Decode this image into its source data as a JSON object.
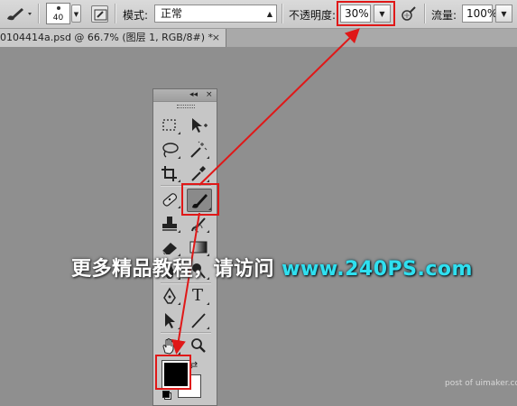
{
  "options_bar": {
    "brush_size": "40",
    "mode_label": "模式:",
    "mode_value": "正常",
    "opacity_label": "不透明度:",
    "opacity_value": "30%",
    "flow_label": "流量:",
    "flow_value": "100%"
  },
  "document_tab": {
    "title": "0104414a.psd @ 66.7% (图层 1, RGB/8#) *",
    "close": "×"
  },
  "tools_panel": {
    "collapse_glyph": "◂◂",
    "close_glyph": "×",
    "foreground_color": "#000000",
    "background_color": "#ffffff",
    "type_tool_glyph": "T"
  },
  "overlay": {
    "watermark_text": "更多精品教程，请访问 ",
    "watermark_site": "www.240PS.com",
    "credit": "post of uimaker.com",
    "annotation_color": "#e01818"
  }
}
